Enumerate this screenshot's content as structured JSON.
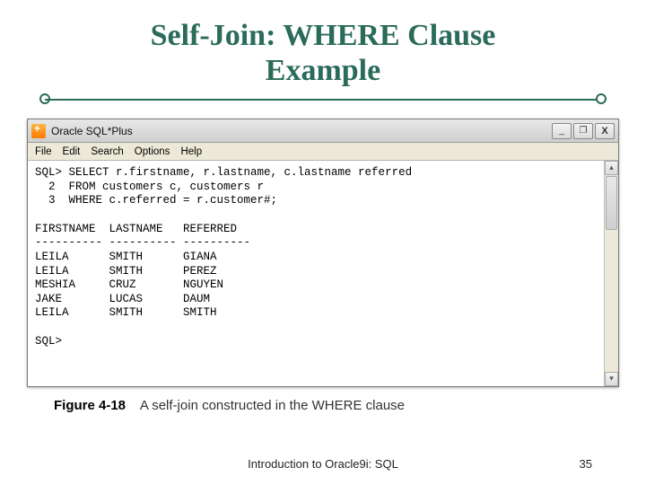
{
  "slide": {
    "title_line1": "Self-Join: WHERE Clause",
    "title_line2": "Example"
  },
  "window": {
    "title": "Oracle SQL*Plus",
    "buttons": {
      "min": "_",
      "max": "❐",
      "close": "X"
    },
    "menu": [
      "File",
      "Edit",
      "Search",
      "Options",
      "Help"
    ]
  },
  "console": {
    "prompt1": "SQL> SELECT r.firstname, r.lastname, c.lastname referred",
    "line2": "  2  FROM customers c, customers r",
    "line3": "  3  WHERE c.referred = r.customer#;",
    "blank1": "",
    "header": "FIRSTNAME  LASTNAME   REFERRED",
    "divider": "---------- ---------- ----------",
    "rows": [
      "LEILA      SMITH      GIANA",
      "LEILA      SMITH      PEREZ",
      "MESHIA     CRUZ       NGUYEN",
      "JAKE       LUCAS      DAUM",
      "LEILA      SMITH      SMITH"
    ],
    "blank2": "",
    "prompt2": "SQL>"
  },
  "caption": {
    "figref": "Figure 4-18",
    "text": "A self-join constructed in the WHERE clause"
  },
  "footer": {
    "center": "Introduction to Oracle9i: SQL",
    "page": "35"
  }
}
